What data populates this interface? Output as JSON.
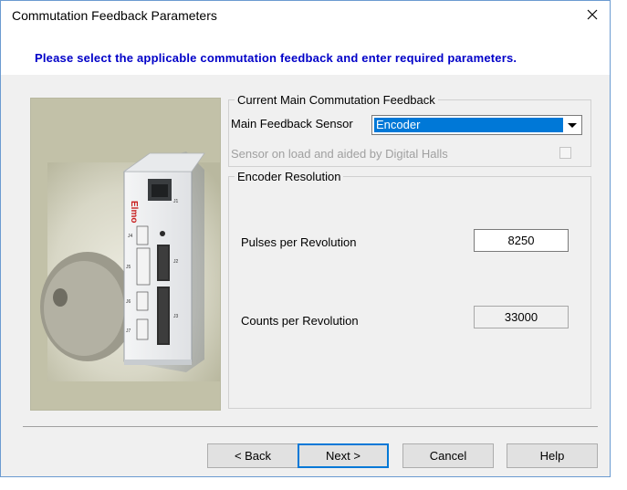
{
  "window": {
    "title": "Commutation Feedback Parameters"
  },
  "header": {
    "instruction": "Please select the applicable commutation feedback and enter required parameters."
  },
  "picture": {
    "brand": "Elmo",
    "connectors": [
      "J1",
      "J2",
      "J3",
      "J4",
      "J5",
      "J6",
      "J7"
    ]
  },
  "main_feedback": {
    "legend": "Current Main Commutation Feedback",
    "sensor_label": "Main Feedback Sensor",
    "sensor_value": "Encoder",
    "halls_label": "Sensor on load and aided by Digital Halls",
    "halls_checked": false
  },
  "encoder_resolution": {
    "legend": "Encoder Resolution",
    "pulses_label": "Pulses per Revolution",
    "pulses_value": "8250",
    "counts_label": "Counts per Revolution",
    "counts_value": "33000"
  },
  "buttons": {
    "back": "< Back",
    "next": "Next >",
    "cancel": "Cancel",
    "help": "Help"
  },
  "colors": {
    "instruction": "#0000c8",
    "selection": "#0078d7",
    "default_button_border": "#0078d7"
  }
}
